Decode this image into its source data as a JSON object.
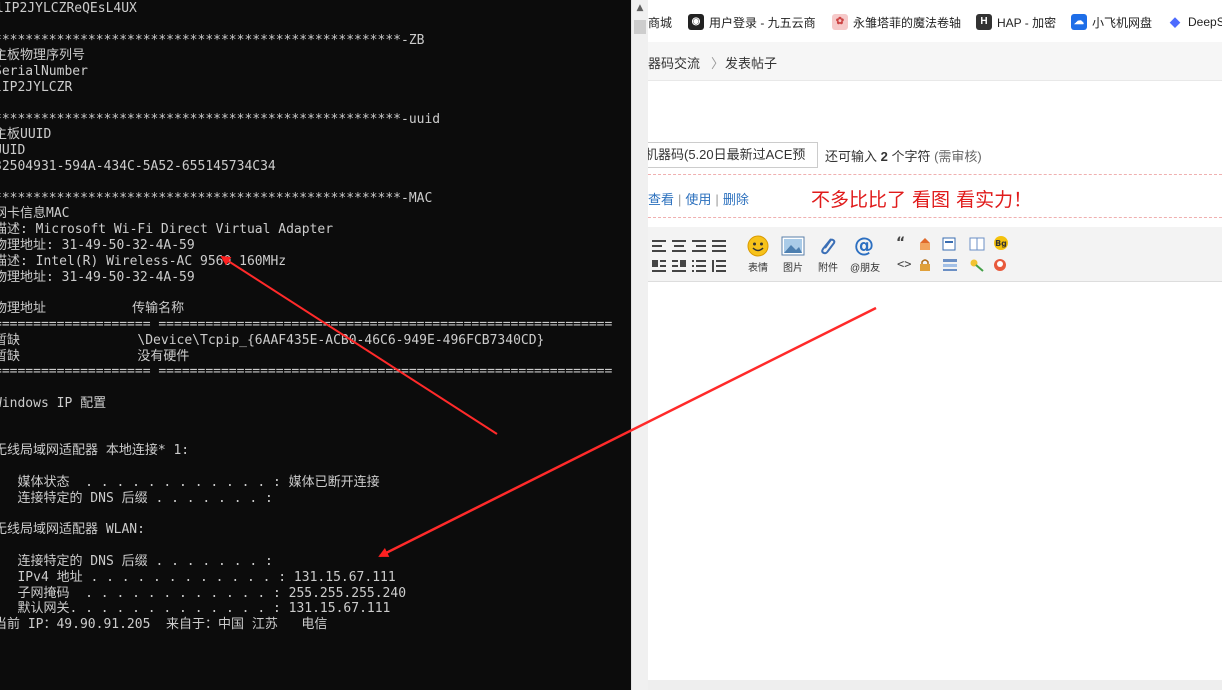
{
  "console": {
    "lines": [
      "lIP2JYLCZReQEsL4UX",
      "",
      "****************************************************-ZB",
      "主板物理序列号",
      "SerialNumber",
      "lIP2JYLCZR",
      "",
      "****************************************************-uuid",
      "主板UUID",
      "UUID",
      "32504931-594A-434C-5A52-655145734C34",
      "",
      "****************************************************-MAC",
      "网卡信息MAC",
      "描述: Microsoft Wi-Fi Direct Virtual Adapter",
      "物理地址: 31-49-50-32-4A-59",
      "描述: Intel(R) Wireless-AC 9560 160MHz",
      "物理地址: 31-49-50-32-4A-59",
      "",
      "物理地址           传输名称",
      "==================== ==========================================================",
      "暂缺               \\Device\\Tcpip_{6AAF435E-ACB0-46C6-949E-496FCB7340CD}",
      "暂缺               没有硬件",
      "==================== ==========================================================",
      "",
      "Windows IP 配置",
      "",
      "",
      "无线局域网适配器 本地连接* 1:",
      "",
      "   媒体状态  . . . . . . . . . . . . : 媒体已断开连接",
      "   连接特定的 DNS 后缀 . . . . . . . :",
      "",
      "无线局域网适配器 WLAN:",
      "",
      "   连接特定的 DNS 后缀 . . . . . . . :",
      "   IPv4 地址 . . . . . . . . . . . . : 131.15.67.111",
      "   子网掩码  . . . . . . . . . . . . : 255.255.255.240",
      "   默认网关. . . . . . . . . . . . . : 131.15.67.111",
      "当前 IP：49.90.91.205  来自于：中国 江苏   电信"
    ]
  },
  "browser": {
    "bookmarks": [
      {
        "label": "商城",
        "icon": "partial-icon"
      },
      {
        "label": "用户登录 - 九五云商",
        "icon": "penguin-icon"
      },
      {
        "label": "永雏塔菲的魔法卷轴",
        "icon": "pig-icon"
      },
      {
        "label": "HAP - 加密",
        "icon": "hap-icon"
      },
      {
        "label": "小飞机网盘",
        "icon": "cloud-drive-icon"
      },
      {
        "label": "DeepS",
        "icon": "deepseek-icon"
      }
    ],
    "breadcrumb": {
      "item1": "器码交流",
      "separator": "〉",
      "item2": "发表帖子"
    },
    "title_input": "机器码(5.20日最新过ACE预",
    "remain": {
      "prefix": "还可输入 ",
      "count": "2",
      "suffix": " 个字符 ",
      "review": "(需审核)"
    },
    "tag_links": {
      "view": "查看",
      "use": "使用",
      "delete": "删除",
      "sep": "|"
    },
    "slogan": "不多比比了 看图 看实力！",
    "toolbar": {
      "emoji": "表情",
      "image": "图片",
      "attach": "附件",
      "mention": "@朋友",
      "quote": "“"
    }
  }
}
